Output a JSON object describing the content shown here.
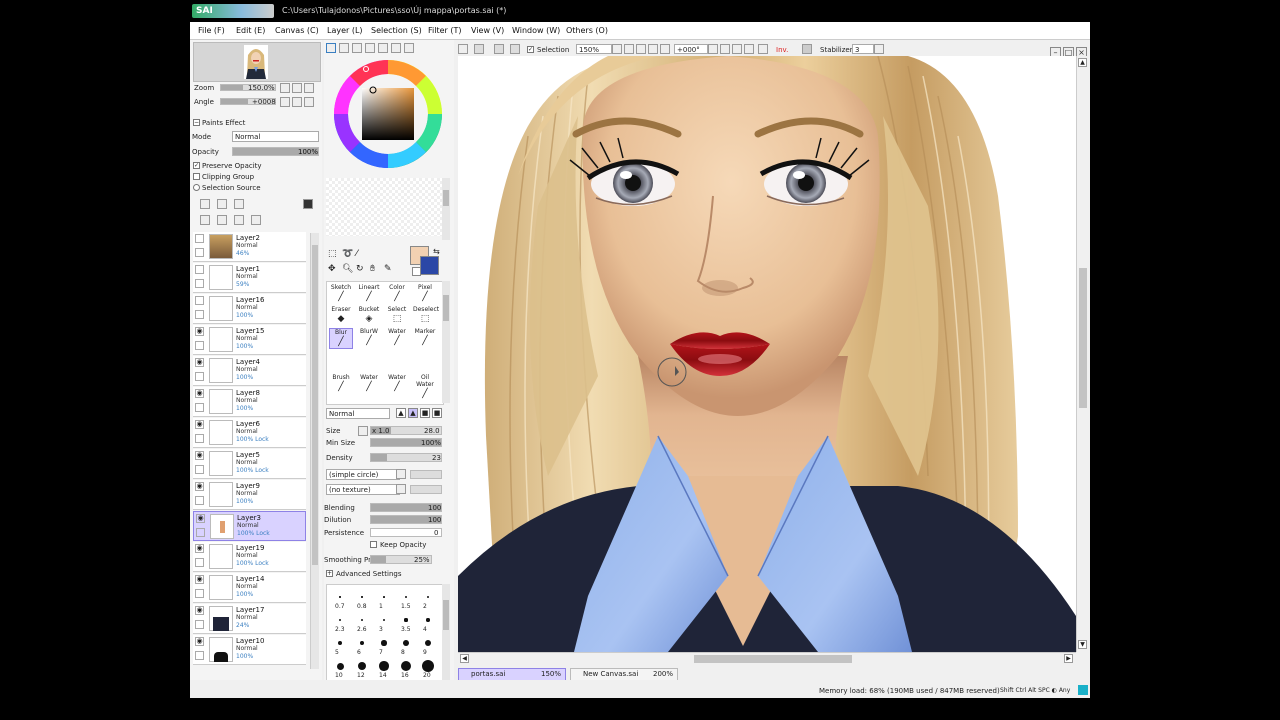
{
  "app": {
    "logo_text": "SAI",
    "title": "C:\\Users\\Tulajdonos\\Pictures\\sso\\Új mappa\\portas.sai (*)"
  },
  "menu": [
    "File (F)",
    "Edit (E)",
    "Canvas (C)",
    "Layer (L)",
    "Selection (S)",
    "Filter (T)",
    "View (V)",
    "Window (W)",
    "Others (O)"
  ],
  "navigator": {
    "zoom_label": "Zoom",
    "zoom_value": "150.0%",
    "angle_label": "Angle",
    "angle_value": "+0008"
  },
  "layer_props": {
    "paints_effect": "Paints Effect",
    "mode_label": "Mode",
    "mode_value": "Normal",
    "opacity_label": "Opacity",
    "opacity_value": "100%",
    "opacity_fraction": 1.0,
    "preserve_opacity": "Preserve Opacity",
    "clipping_group": "Clipping Group",
    "selection_source": "Selection Source"
  },
  "layers": [
    {
      "name": "Layer2",
      "mode": "Normal",
      "opacity": "46%",
      "lock": "",
      "visible": false,
      "selected": false
    },
    {
      "name": "Layer1",
      "mode": "Normal",
      "opacity": "59%",
      "lock": "",
      "visible": false,
      "selected": false
    },
    {
      "name": "Layer16",
      "mode": "Normal",
      "opacity": "100%",
      "lock": "",
      "visible": false,
      "selected": false
    },
    {
      "name": "Layer15",
      "mode": "Normal",
      "opacity": "100%",
      "lock": "",
      "visible": true,
      "selected": false
    },
    {
      "name": "Layer4",
      "mode": "Normal",
      "opacity": "100%",
      "lock": "",
      "visible": true,
      "selected": false
    },
    {
      "name": "Layer8",
      "mode": "Normal",
      "opacity": "100%",
      "lock": "",
      "visible": true,
      "selected": false
    },
    {
      "name": "Layer6",
      "mode": "Normal",
      "opacity": "100%",
      "lock": "Lock",
      "visible": true,
      "selected": false
    },
    {
      "name": "Layer5",
      "mode": "Normal",
      "opacity": "100%",
      "lock": "Lock",
      "visible": true,
      "selected": false
    },
    {
      "name": "Layer9",
      "mode": "Normal",
      "opacity": "100%",
      "lock": "",
      "visible": true,
      "selected": false
    },
    {
      "name": "Layer3",
      "mode": "Normal",
      "opacity": "100%",
      "lock": "Lock",
      "visible": true,
      "selected": true
    },
    {
      "name": "Layer19",
      "mode": "Normal",
      "opacity": "100%",
      "lock": "Lock",
      "visible": true,
      "selected": false
    },
    {
      "name": "Layer14",
      "mode": "Normal",
      "opacity": "100%",
      "lock": "",
      "visible": true,
      "selected": false
    },
    {
      "name": "Layer17",
      "mode": "Normal",
      "opacity": "24%",
      "lock": "",
      "visible": true,
      "selected": false
    },
    {
      "name": "Layer10",
      "mode": "Normal",
      "opacity": "100%",
      "lock": "",
      "visible": true,
      "selected": false
    }
  ],
  "tools": {
    "row1": [
      "Sketch",
      "Lineart",
      "Color",
      "Pixel"
    ],
    "row2": [
      "Eraser",
      "Bucket",
      "Select",
      "Deselect"
    ],
    "row3": [
      "Blur",
      "BlurW",
      "Water",
      "Marker"
    ],
    "row4": [
      "Brush",
      "Water",
      "Water",
      "Oil Water"
    ],
    "selected": "Blur"
  },
  "brush": {
    "blend_mode": "Normal",
    "size_label": "Size",
    "size_mult": "x 1.0",
    "size_value": "28.0",
    "min_size_label": "Min Size",
    "min_size_value": "100%",
    "density_label": "Density",
    "density_value": "23",
    "shape": "(simple circle)",
    "texture": "(no texture)",
    "blending_label": "Blending",
    "blending_value": "100",
    "dilution_label": "Dilution",
    "dilution_value": "100",
    "persistence_label": "Persistence",
    "persistence_value": "0",
    "keep_opacity": "Keep Opacity",
    "smoothing_label": "Smoothing Pre",
    "smoothing_value": "25%",
    "advanced": "Advanced Settings",
    "sizes": [
      "0.7",
      "0.8",
      "1",
      "1.5",
      "2",
      "2.3",
      "2.6",
      "3",
      "3.5",
      "4",
      "5",
      "6",
      "7",
      "8",
      "9",
      "10",
      "12",
      "14",
      "16",
      "20"
    ]
  },
  "canvas_toolbar": {
    "selection": "Selection",
    "zoom": "150%",
    "angle": "+000°",
    "inv": "Inv.",
    "stabilizer_label": "Stabilizer",
    "stabilizer_value": "3"
  },
  "tabs": [
    {
      "name": "portas.sai",
      "zoom": "150%",
      "active": true
    },
    {
      "name": "New Canvas.sai",
      "zoom": "200%",
      "active": false
    }
  ],
  "status": {
    "memory": "Memory load: 68% (190MB used / 847MB reserved)",
    "keys": "Shift Ctrl Alt SPC ◐ Any"
  },
  "colors": {
    "primary": "#f2d1b2",
    "secondary": "#2b47a6",
    "selection_bg": "#d9d2ff"
  }
}
